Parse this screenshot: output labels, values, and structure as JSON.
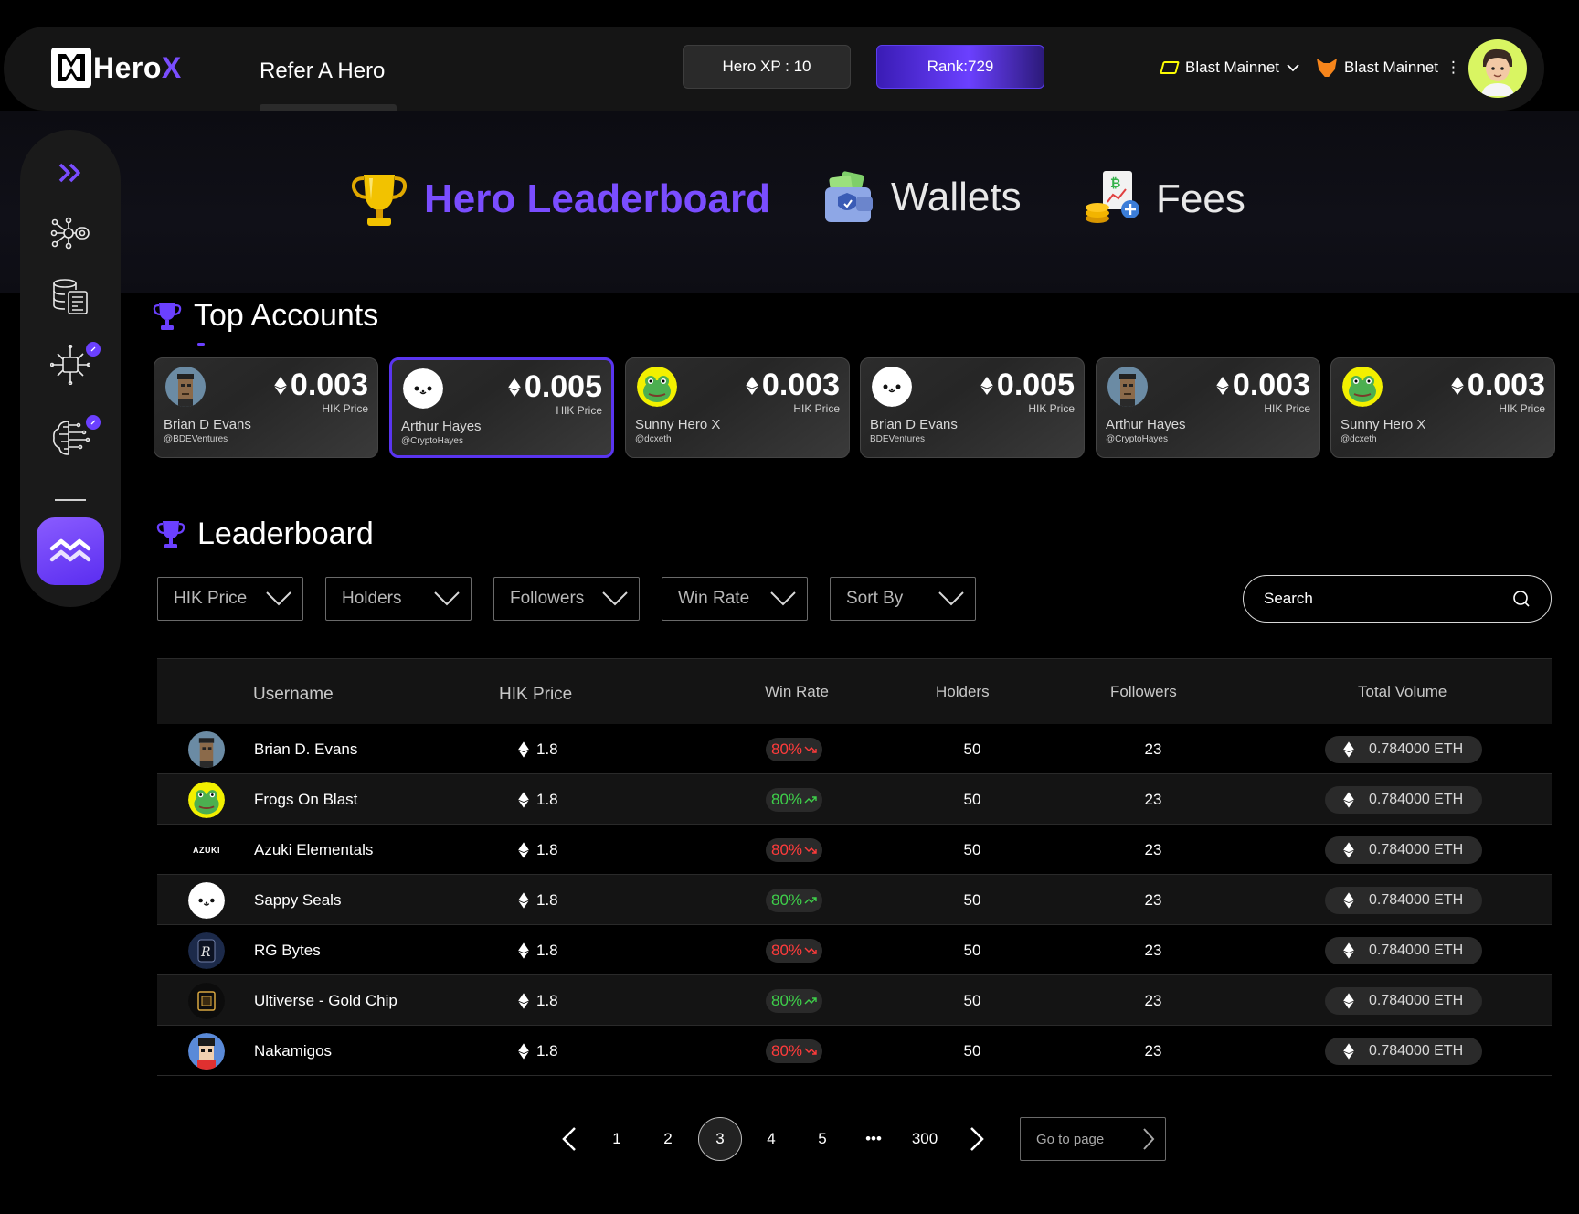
{
  "header": {
    "logo_hero": "Hero",
    "logo_x": "X",
    "refer_label": "Refer A Hero",
    "xp_label": "Hero XP : 10",
    "rank_label": "Rank:729",
    "network1_label": "Blast Mainnet",
    "network2_label": "Blast Mainnet",
    "network2_more": "⋮"
  },
  "nav_tabs": [
    {
      "label": "Hero Leaderboard",
      "icon": "trophy-icon",
      "active": true
    },
    {
      "label": "Wallets",
      "icon": "wallet-icon",
      "active": false
    },
    {
      "label": "Fees",
      "icon": "fees-coins-icon",
      "active": false
    }
  ],
  "sidebar": {
    "items": [
      "expand-chevrons-icon",
      "network-nodes-icon",
      "database-report-icon",
      "chip-circuit-icon",
      "brain-circuit-icon"
    ],
    "active_item": "wave-logo-icon"
  },
  "top_accounts": {
    "title": "Top Accounts",
    "cards": [
      {
        "price": "0.003",
        "price_label": "HIK Price",
        "name": "Brian D Evans",
        "handle": "@BDEVentures",
        "avatar": "punk",
        "selected": false
      },
      {
        "price": "0.005",
        "price_label": "HIK Price",
        "name": "Arthur Hayes",
        "handle": "@CryptoHayes",
        "avatar": "seal",
        "selected": true
      },
      {
        "price": "0.003",
        "price_label": "HIK Price",
        "name": "Sunny Hero X",
        "handle": "@dcxeth",
        "avatar": "frog",
        "selected": false
      },
      {
        "price": "0.005",
        "price_label": "HIK Price",
        "name": "Brian D Evans",
        "handle": "BDEVentures",
        "avatar": "seal",
        "selected": false
      },
      {
        "price": "0.003",
        "price_label": "HIK Price",
        "name": "Arthur Hayes",
        "handle": "@CryptoHayes",
        "avatar": "punk",
        "selected": false
      },
      {
        "price": "0.003",
        "price_label": "HIK Price",
        "name": "Sunny Hero X",
        "handle": "@dcxeth",
        "avatar": "frog",
        "selected": false
      }
    ]
  },
  "leaderboard": {
    "title": "Leaderboard",
    "filters": [
      "HIK Price",
      "Holders",
      "Followers",
      "Win Rate",
      "Sort By"
    ],
    "search_placeholder": "Search",
    "columns": [
      "Username",
      "HIK Price",
      "Win Rate",
      "Holders",
      "Followers",
      "Total Volume"
    ],
    "rows": [
      {
        "avatar": "punk",
        "username": "Brian D. Evans",
        "price": "1.8",
        "win_rate": "80%",
        "trend": "down",
        "holders": "50",
        "followers": "23",
        "volume": "0.784000 ETH"
      },
      {
        "avatar": "frog",
        "username": "Frogs On Blast",
        "price": "1.8",
        "win_rate": "80%",
        "trend": "up",
        "holders": "50",
        "followers": "23",
        "volume": "0.784000 ETH"
      },
      {
        "avatar": "azuki",
        "username": "Azuki Elementals",
        "price": "1.8",
        "win_rate": "80%",
        "trend": "down",
        "holders": "50",
        "followers": "23",
        "volume": "0.784000 ETH"
      },
      {
        "avatar": "seal",
        "username": "Sappy Seals",
        "price": "1.8",
        "win_rate": "80%",
        "trend": "up",
        "holders": "50",
        "followers": "23",
        "volume": "0.784000 ETH"
      },
      {
        "avatar": "rg",
        "username": "RG Bytes",
        "price": "1.8",
        "win_rate": "80%",
        "trend": "down",
        "holders": "50",
        "followers": "23",
        "volume": "0.784000 ETH"
      },
      {
        "avatar": "ultiverse",
        "username": "Ultiverse - Gold Chip",
        "price": "1.8",
        "win_rate": "80%",
        "trend": "up",
        "holders": "50",
        "followers": "23",
        "volume": "0.784000 ETH"
      },
      {
        "avatar": "nakamigos",
        "username": "Nakamigos",
        "price": "1.8",
        "win_rate": "80%",
        "trend": "down",
        "holders": "50",
        "followers": "23",
        "volume": "0.784000 ETH"
      }
    ],
    "azuki_logo_text": "AZUKI"
  },
  "pagination": {
    "pages": [
      "1",
      "2",
      "3",
      "4",
      "5",
      "•••",
      "300"
    ],
    "current": "3",
    "goto_placeholder": "Go to page"
  },
  "colors": {
    "accent": "#7a4dff",
    "up": "#3ecf4a",
    "down": "#ff3b3b"
  }
}
